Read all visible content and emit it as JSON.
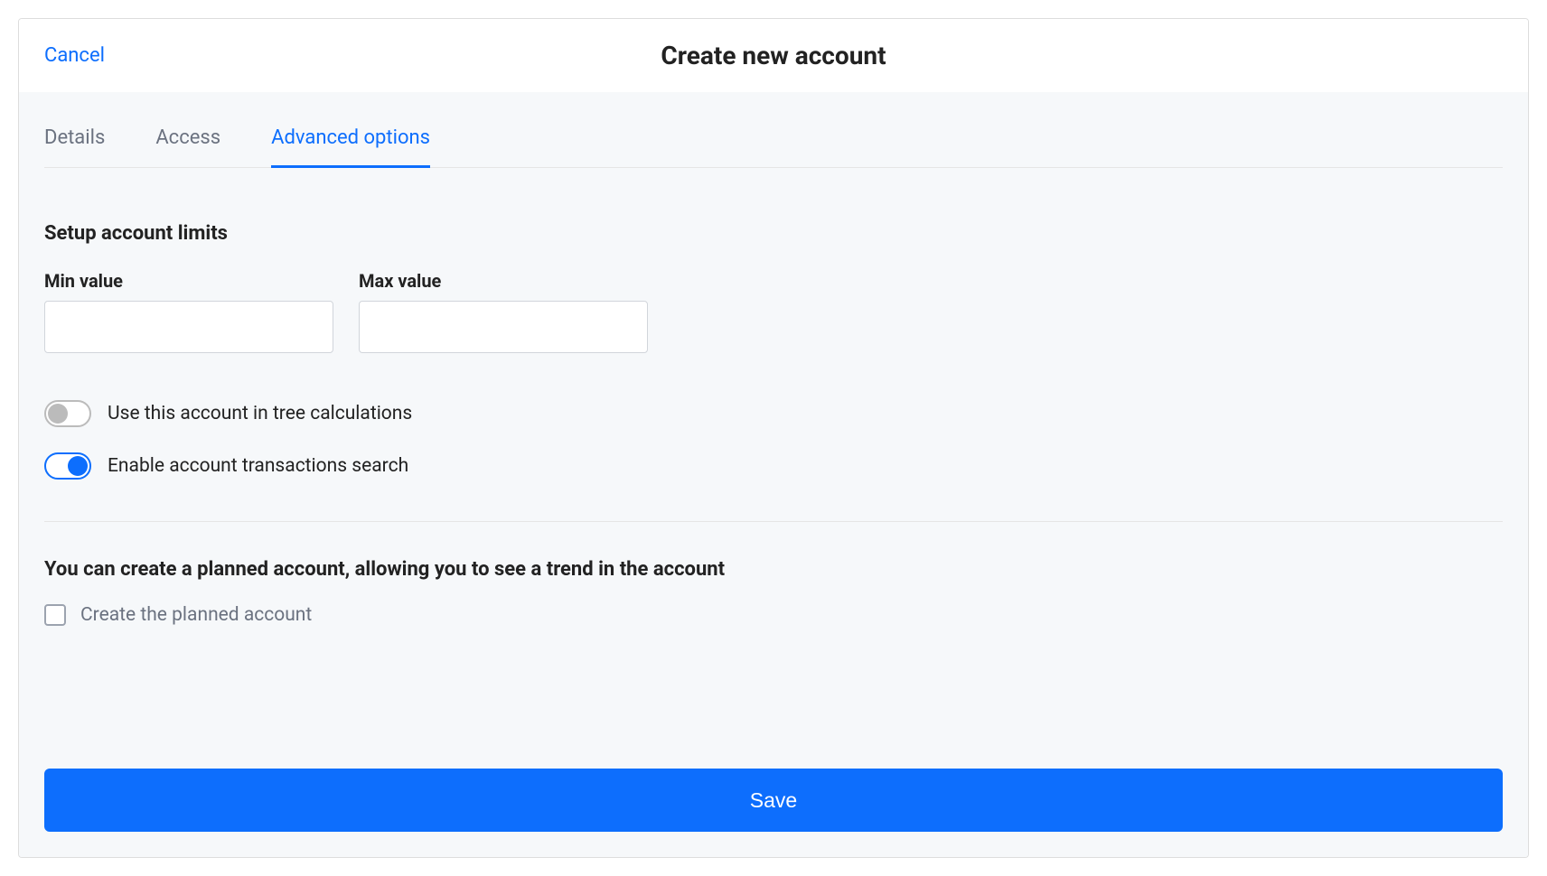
{
  "header": {
    "cancel_label": "Cancel",
    "title": "Create new account"
  },
  "tabs": [
    {
      "label": "Details",
      "active": false
    },
    {
      "label": "Access",
      "active": false
    },
    {
      "label": "Advanced options",
      "active": true
    }
  ],
  "limits": {
    "heading": "Setup account limits",
    "min_label": "Min value",
    "min_value": "",
    "max_label": "Max value",
    "max_value": ""
  },
  "toggles": {
    "tree_calc": {
      "label": "Use this account in tree calculations",
      "on": false
    },
    "tx_search": {
      "label": "Enable account transactions search",
      "on": true
    }
  },
  "planned": {
    "info": "You can create a planned account, allowing you to see a trend in the account",
    "checkbox_label": "Create the planned account",
    "checked": false
  },
  "footer": {
    "save_label": "Save"
  }
}
